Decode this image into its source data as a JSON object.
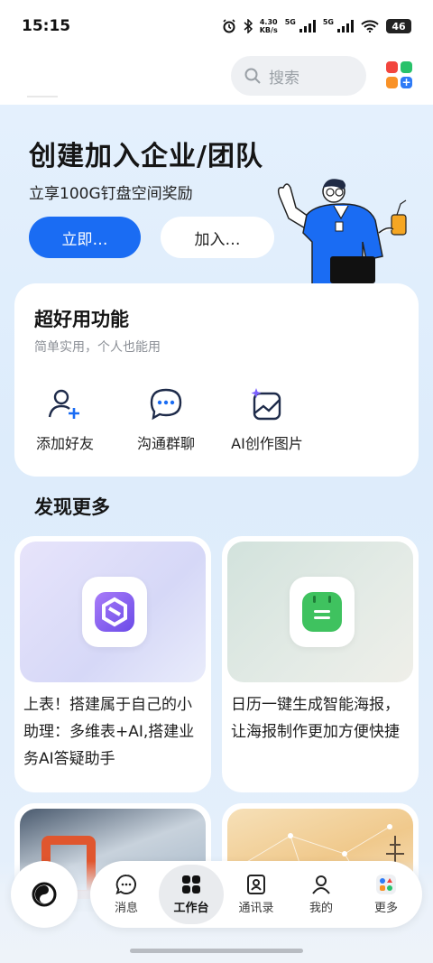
{
  "status_bar": {
    "time": "15:15",
    "network_speed_value": "4.30",
    "network_speed_unit": "KB/s",
    "sim1_label": "5G",
    "sim2_label": "5G",
    "battery": "46"
  },
  "topbar": {
    "search_placeholder": "搜索"
  },
  "hero": {
    "title": "创建加入企业/团队",
    "subtitle": "立享100G钉盘空间奖励",
    "primary_button": "立即…",
    "secondary_button": "加入…"
  },
  "features": {
    "title": "超好用功能",
    "description": "简单实用，个人也能用",
    "items": [
      {
        "label": "添加好友",
        "icon": "add-friend-icon"
      },
      {
        "label": "沟通群聊",
        "icon": "group-chat-icon"
      },
      {
        "label": "AI创作图片",
        "icon": "ai-image-icon"
      }
    ]
  },
  "discover": {
    "title": "发现更多",
    "cards": [
      {
        "text": "上表！搭建属于自己的小助理：多维表+AI,搭建业务AI答疑助手",
        "icon": "multidim-table-icon"
      },
      {
        "text": "日历一键生成智能海报，让海报制作更加方便快捷",
        "icon": "calendar-icon"
      }
    ]
  },
  "bottom_nav": {
    "tabs": [
      {
        "label": "消息",
        "icon": "message-icon"
      },
      {
        "label": "工作台",
        "icon": "workbench-icon",
        "active": true
      },
      {
        "label": "通讯录",
        "icon": "contacts-icon"
      },
      {
        "label": "我的",
        "icon": "profile-icon"
      },
      {
        "label": "更多",
        "icon": "more-apps-icon"
      }
    ]
  },
  "colors": {
    "accent": "#1a6cf3",
    "hero_bg": "#e4f0fd"
  }
}
